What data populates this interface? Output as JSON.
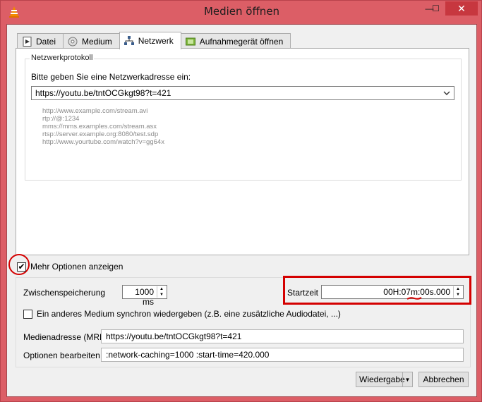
{
  "window": {
    "title": "Medien öffnen",
    "minimize_symbol": "—",
    "maximize_symbol": "☐",
    "close_symbol": "✕"
  },
  "tabs": [
    {
      "label": "Datei",
      "icon": "file-icon"
    },
    {
      "label": "Medium",
      "icon": "disc-icon"
    },
    {
      "label": "Netzwerk",
      "icon": "network-icon",
      "active": true
    },
    {
      "label": "Aufnahmegerät öffnen",
      "icon": "capture-device-icon"
    }
  ],
  "network": {
    "group_title": "Netzwerkprotokoll",
    "prompt": "Bitte geben Sie eine Netzwerkadresse ein:",
    "url_value": "https://youtu.be/tntOCGkgt98?t=421",
    "examples": [
      "http://www.example.com/stream.avi",
      "rtp://@:1234",
      "mms://mms.examples.com/stream.asx",
      "rtsp://server.example.org:8080/test.sdp",
      "http://www.yourtube.com/watch?v=gg64x"
    ]
  },
  "more_options": {
    "label": "Mehr Optionen anzeigen",
    "checked": true,
    "check_glyph": "✔"
  },
  "options": {
    "caching_label": "Zwischenspeicherung",
    "caching_value": "1000 ms",
    "start_label": "Startzeit",
    "start_value": "00H:07m:00s.000",
    "sync_label": "Ein anderes Medium synchron wiedergeben (z.B. eine zusätzliche Audiodatei, ...)",
    "mrl_label": "Medienadresse (MRL)",
    "mrl_value": "https://youtu.be/tntOCGkgt98?t=421",
    "edit_label": "Optionen bearbeiten",
    "edit_value": ":network-caching=1000 :start-time=420.000",
    "spin_up": "▲",
    "spin_down": "▼"
  },
  "buttons": {
    "play": "Wiedergabe",
    "play_arrow": "▼",
    "cancel": "Abbrechen"
  },
  "colors": {
    "window_frame": "#dc5e66",
    "annotation_red": "#d40000"
  }
}
